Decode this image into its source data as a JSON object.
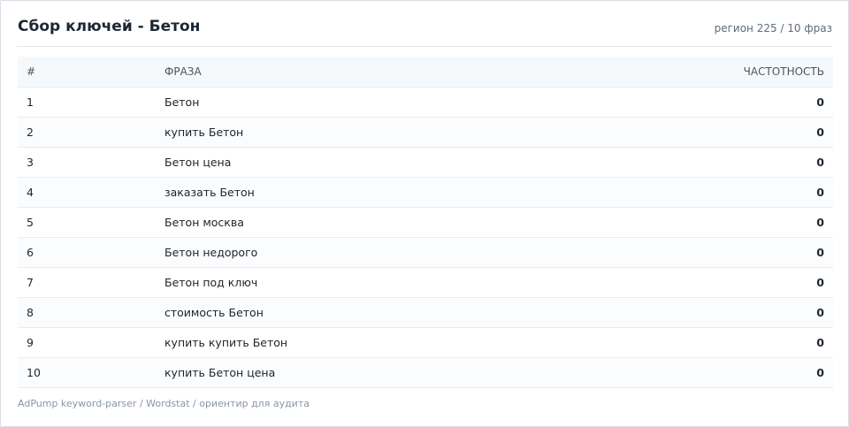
{
  "header": {
    "title": "Сбор ключей - Бетон",
    "meta": "регион 225 / 10 фраз"
  },
  "table": {
    "columns": {
      "num": "#",
      "phrase": "ФРАЗА",
      "freq": "ЧАСТОТНОСТЬ"
    },
    "rows": [
      {
        "num": "1",
        "phrase": "Бетон",
        "freq": "0"
      },
      {
        "num": "2",
        "phrase": "купить Бетон",
        "freq": "0"
      },
      {
        "num": "3",
        "phrase": "Бетон цена",
        "freq": "0"
      },
      {
        "num": "4",
        "phrase": "заказать Бетон",
        "freq": "0"
      },
      {
        "num": "5",
        "phrase": "Бетон москва",
        "freq": "0"
      },
      {
        "num": "6",
        "phrase": "Бетон недорого",
        "freq": "0"
      },
      {
        "num": "7",
        "phrase": "Бетон под ключ",
        "freq": "0"
      },
      {
        "num": "8",
        "phrase": "стоимость Бетон",
        "freq": "0"
      },
      {
        "num": "9",
        "phrase": "купить купить Бетон",
        "freq": "0"
      },
      {
        "num": "10",
        "phrase": "купить Бетон цена",
        "freq": "0"
      }
    ]
  },
  "footer": {
    "text": "AdPump keyword-parser / Wordstat / ориентир для аудита"
  }
}
